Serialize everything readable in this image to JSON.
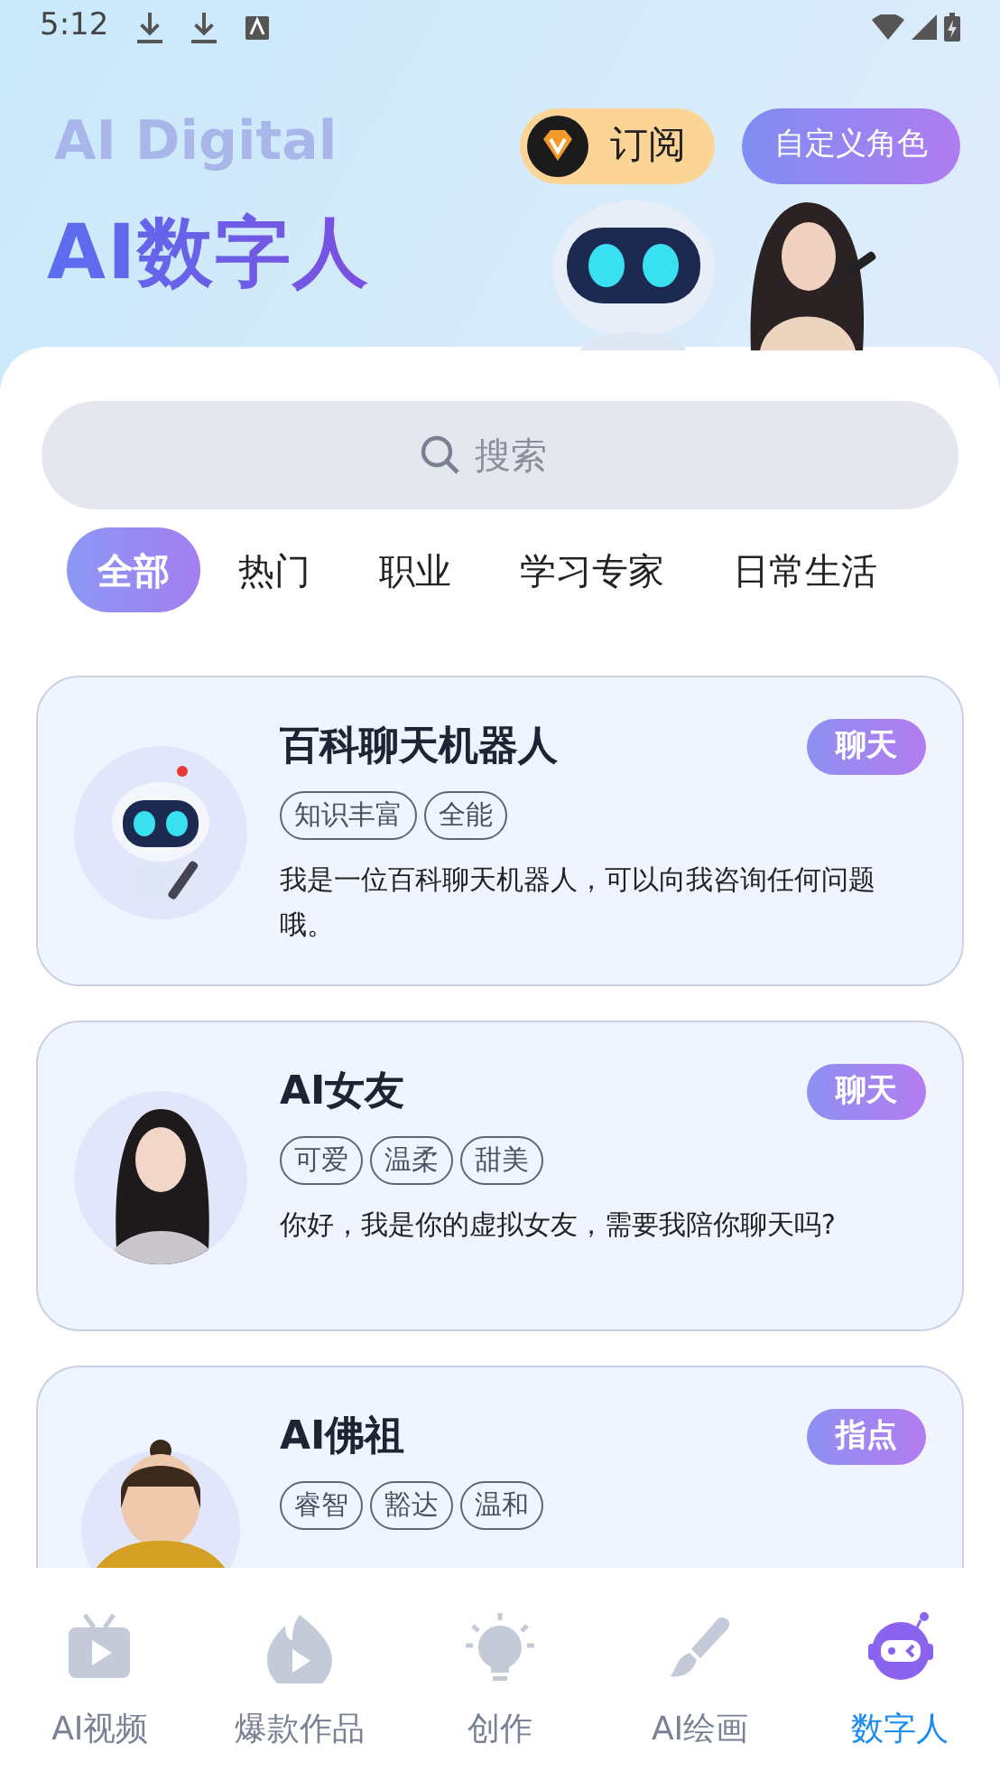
{
  "status_bar": {
    "time": "5:12"
  },
  "header": {
    "title": "AI数字人",
    "backdrop_text": "AI Digital",
    "subscribe_button": "订阅",
    "custom_button": "自定义角色"
  },
  "search": {
    "placeholder": "搜索"
  },
  "categories": [
    {
      "label": "全部",
      "selected": true
    },
    {
      "label": "热门",
      "selected": false
    },
    {
      "label": "职业",
      "selected": false
    },
    {
      "label": "学习专家",
      "selected": false
    },
    {
      "label": "日常生活",
      "selected": false
    }
  ],
  "cards": [
    {
      "name": "百科聊天机器人",
      "action": "聊天",
      "tags": [
        "知识丰富",
        "全能"
      ],
      "description": "我是一位百科聊天机器人，可以向我咨询任何问题哦。"
    },
    {
      "name": "AI女友",
      "action": "聊天",
      "tags": [
        "可爱",
        "温柔",
        "甜美"
      ],
      "description": "你好，我是你的虚拟女友，需要我陪你聊天吗?"
    },
    {
      "name": "AI佛祖",
      "action": "指点",
      "tags": [
        "睿智",
        "豁达",
        "温和"
      ]
    }
  ],
  "bottom_nav": [
    {
      "label": "AI视频",
      "selected": false
    },
    {
      "label": "爆款作品",
      "selected": false
    },
    {
      "label": "创作",
      "selected": false
    },
    {
      "label": "AI绘画",
      "selected": false
    },
    {
      "label": "数字人",
      "selected": true
    }
  ]
}
